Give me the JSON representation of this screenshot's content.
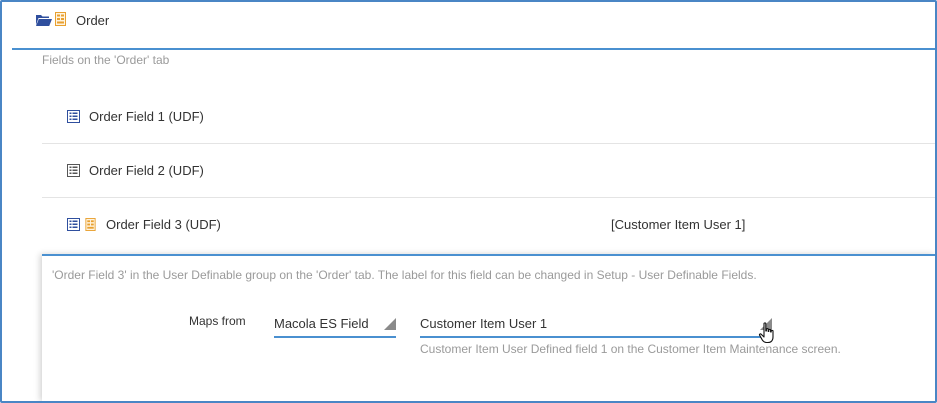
{
  "header": {
    "title": "Order",
    "folder_icon": "folder-open-icon",
    "tag_icon": "udf-tag-icon"
  },
  "section": {
    "caption": "Fields on the 'Order' tab"
  },
  "rows": [
    {
      "label": "Order Field 1 (UDF)",
      "mapped_value": ""
    },
    {
      "label": "Order Field 2 (UDF)",
      "mapped_value": ""
    },
    {
      "label": "Order Field 3 (UDF)",
      "mapped_value": "[Customer Item User 1]"
    }
  ],
  "detail": {
    "description": "'Order Field 3' in the User Definable group on the 'Order' tab. The label for this field can be changed in Setup - User Definable Fields.",
    "maps_from_label": "Maps from",
    "source_select": {
      "value": "Macola ES Field"
    },
    "field_select": {
      "value": "Customer Item User 1",
      "help": "Customer Item User Defined field 1 on the Customer Item Maintenance screen."
    }
  },
  "colors": {
    "accent": "#4a90d0",
    "frame": "#4a86c5",
    "muted_text": "#9a9a9a",
    "icon_blue": "#2f4f9e",
    "icon_orange": "#e8a030"
  }
}
